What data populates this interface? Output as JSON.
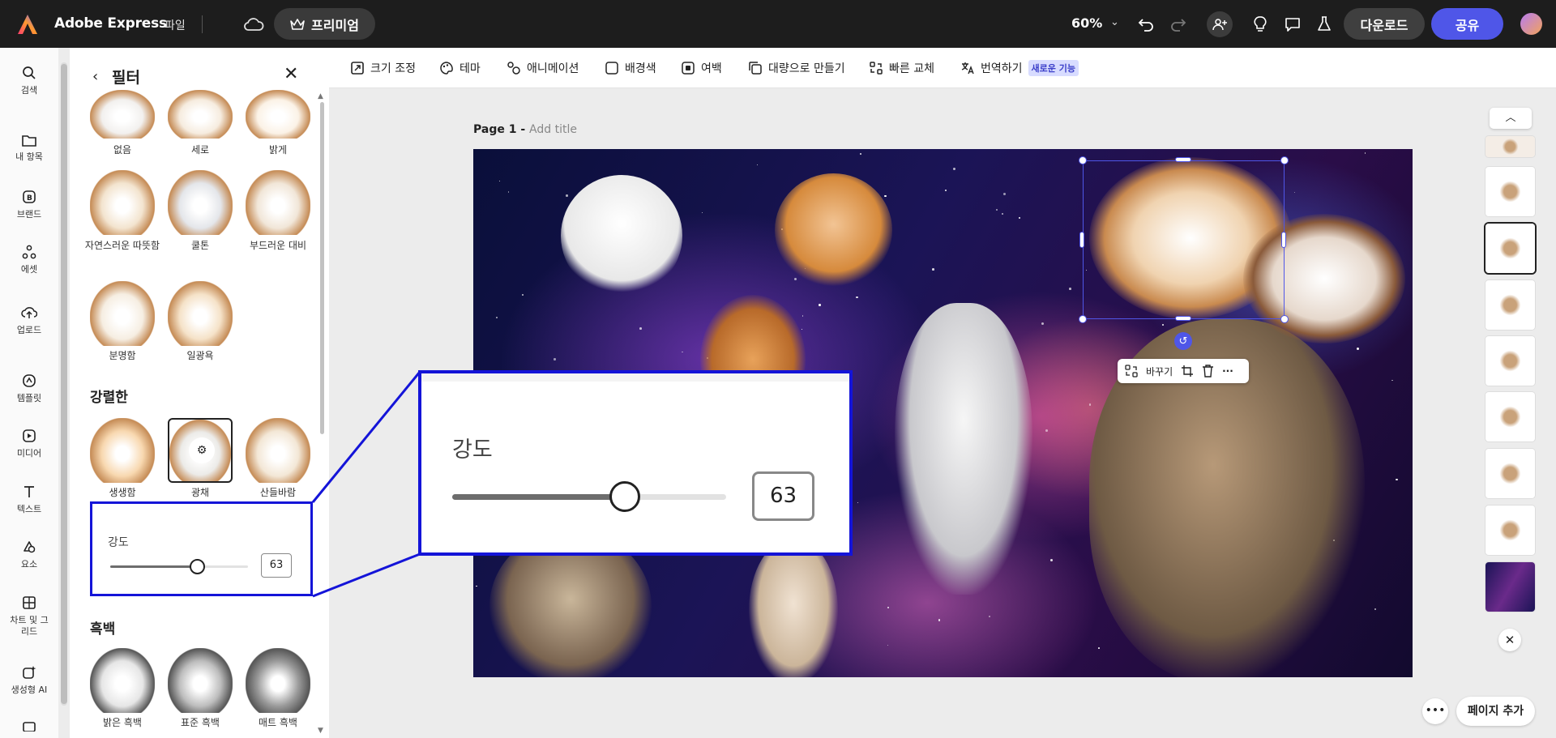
{
  "header": {
    "app_title": "Adobe Express",
    "file_menu": "파일",
    "premium_label": "프리미엄",
    "zoom": "60%",
    "download_label": "다운로드",
    "share_label": "공유",
    "brand_colors": {
      "topbar": "#1d1d1d",
      "share": "#4f56e8"
    }
  },
  "rail": {
    "items": [
      {
        "label": "검색",
        "icon": "search-icon"
      },
      {
        "label": "내 항목",
        "icon": "folder-icon"
      },
      {
        "label": "브랜드",
        "icon": "brand-icon"
      },
      {
        "label": "에셋",
        "icon": "assets-icon"
      },
      {
        "label": "업로드",
        "icon": "upload-icon"
      },
      {
        "label": "템플릿",
        "icon": "template-icon"
      },
      {
        "label": "미디어",
        "icon": "media-icon"
      },
      {
        "label": "텍스트",
        "icon": "text-icon"
      },
      {
        "label": "요소",
        "icon": "elements-icon"
      },
      {
        "label": "차트 및 그리드",
        "icon": "chart-grid-icon"
      },
      {
        "label": "생성형 AI",
        "icon": "genai-icon"
      }
    ]
  },
  "panel": {
    "title": "필터",
    "row0": [
      "없음",
      "세로",
      "밝게"
    ],
    "row1": [
      "자연스러운 따뜻함",
      "쿨톤",
      "부드러운 대비"
    ],
    "row2": [
      "분명함",
      "일광욕"
    ],
    "section_strong": "강렬한",
    "row3": [
      "생생함",
      "광채",
      "산들바람"
    ],
    "intensity_label": "강도",
    "intensity_value": "63",
    "intensity_fraction": 0.63,
    "section_bw": "흑백",
    "row4": [
      "밝은 흑백",
      "표준 흑백",
      "매트 흑백"
    ]
  },
  "toolbar": {
    "items": [
      {
        "label": "크기 조정",
        "icon": "resize-icon"
      },
      {
        "label": "테마",
        "icon": "palette-icon"
      },
      {
        "label": "애니메이션",
        "icon": "animation-icon"
      },
      {
        "label": "배경색",
        "icon": "bg-color-icon"
      },
      {
        "label": "여백",
        "icon": "padding-icon"
      },
      {
        "label": "대량으로 만들기",
        "icon": "bulk-create-icon"
      },
      {
        "label": "빠른 교체",
        "icon": "quick-swap-icon"
      },
      {
        "label": "번역하기",
        "icon": "translate-icon"
      }
    ],
    "new_badge": "새로운 기능"
  },
  "canvas": {
    "page_label": "Page 1 -",
    "add_title": "Add title",
    "context_replace": "바꾸기"
  },
  "callout": {
    "label": "강도",
    "value": "63"
  },
  "footer": {
    "add_page": "페이지 추가"
  }
}
